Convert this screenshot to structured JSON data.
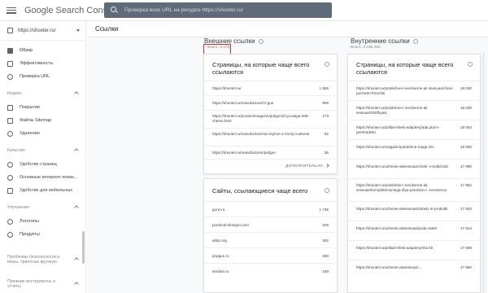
{
  "topbar": {
    "app_title": "Google Search Console",
    "search_placeholder": "Проверка всех URL на ресурсе https://shooter.ru/"
  },
  "sidebar": {
    "property": "https://shooter.ru/",
    "items_top": [
      {
        "label": "Обзор",
        "icon": "home-icon"
      },
      {
        "label": "Эффективность",
        "icon": "trend-icon"
      },
      {
        "label": "Проверка URL",
        "icon": "search-icon"
      }
    ],
    "section_index": "Индекс",
    "items_index": [
      {
        "label": "Покрытие",
        "icon": "coverage-icon"
      },
      {
        "label": "Файлы Sitemap",
        "icon": "sitemap-icon"
      },
      {
        "label": "Удаления",
        "icon": "removals-icon"
      }
    ],
    "section_quality": "Качество",
    "items_quality": [
      {
        "label": "Удобство страниц",
        "icon": "page-experience-icon"
      },
      {
        "label": "Основные интернет-показ...",
        "icon": "web-vitals-icon"
      },
      {
        "label": "Удобство для мобильных",
        "icon": "mobile-icon"
      }
    ],
    "section_enhancements": "Улучшения",
    "items_enhancements": [
      {
        "label": "Логотипы",
        "icon": "logo-icon"
      },
      {
        "label": "Продукты",
        "icon": "products-icon"
      }
    ],
    "section_security": "Проблемы безопасности и меры, принятые вручную",
    "section_legacy": "Прежние инструменты и отчеты"
  },
  "main": {
    "page_title": "Ссылки",
    "external": {
      "title": "Внешние ссылки",
      "total": "Всего: 3 476",
      "top_pages": {
        "title": "Страницы, на которые чаще всего ссылаются",
        "rows": [
          {
            "url": "https://shooter.ru/",
            "value": "1 855"
          },
          {
            "url": "https://shooter.ru/manufacturer/z-gun",
            "value": "806"
          },
          {
            "url": "https://shooter.ru/product/magazin/pufgun/dl ya-saiga-308-chems.html",
            "value": "173"
          },
          {
            "url": "https://shooter.ru/manufacturer/ac-leylom-a rmory-customs",
            "value": "62"
          },
          {
            "url": "https://shooter.ru/manufacturer/pufgun",
            "value": "35"
          }
        ],
        "more": "ДОПОЛНИТЕЛЬНО"
      },
      "top_sites": {
        "title": "Сайты, ссылающиеся чаще всего",
        "rows": [
          {
            "url": "guns.ru",
            "value": "1 735"
          },
          {
            "url": "practical-shotgun.com",
            "value": "549"
          },
          {
            "url": "altirp.org",
            "value": "362"
          },
          {
            "url": "pnpgun.ru",
            "value": "290"
          },
          {
            "url": "seoden.ru",
            "value": "190"
          }
        ]
      }
    },
    "internal": {
      "title": "Внутренние ссылки",
      "total": "Всего: 3 238 282",
      "top_pages": {
        "title": "Страницы, на которые чаще всего ссылаются",
        "rows": [
          {
            "url": "https://shooter.ru/potolehne-i-revolverne-ak sessuari/chexi-puchetm-frenchki",
            "value": "18 040"
          },
          {
            "url": "https://shooter.ru/potolehne-i-revolverne-ak sessuari/shtifhyats",
            "value": "18 030"
          },
          {
            "url": "https://shooter.ru/prillad-sheki-adaptery/ada ptori-i-perehodniki",
            "value": "18 004"
          },
          {
            "url": "https://shooter.ru/magazin/potolehne-maga zini",
            "value": "18 000"
          },
          {
            "url": "https://shooter.ru/uzhenie-aksessuari/cheki -i-multichoki",
            "value": "17 996"
          },
          {
            "url": "https://shooter.ru/potolehne-i-revolverne-ak sessuari/komplekti-tuninga-dlya-potolotov-i -revolverov",
            "value": "17 952"
          },
          {
            "url": "https://shooter.ru/uzhenie-aksessuari/sobstv ie-probotki",
            "value": "17 920"
          },
          {
            "url": "https://shooter.ru/uzhenie-aksessuari/poda vatelt",
            "value": "17 914"
          },
          {
            "url": "https://shooter.ru/prillad-sheki-adaptery/sha bli",
            "value": "17 908"
          },
          {
            "url": "https://shooter.ru/uzhenie-aksessuari/...",
            "value": "17 860"
          }
        ]
      }
    }
  }
}
